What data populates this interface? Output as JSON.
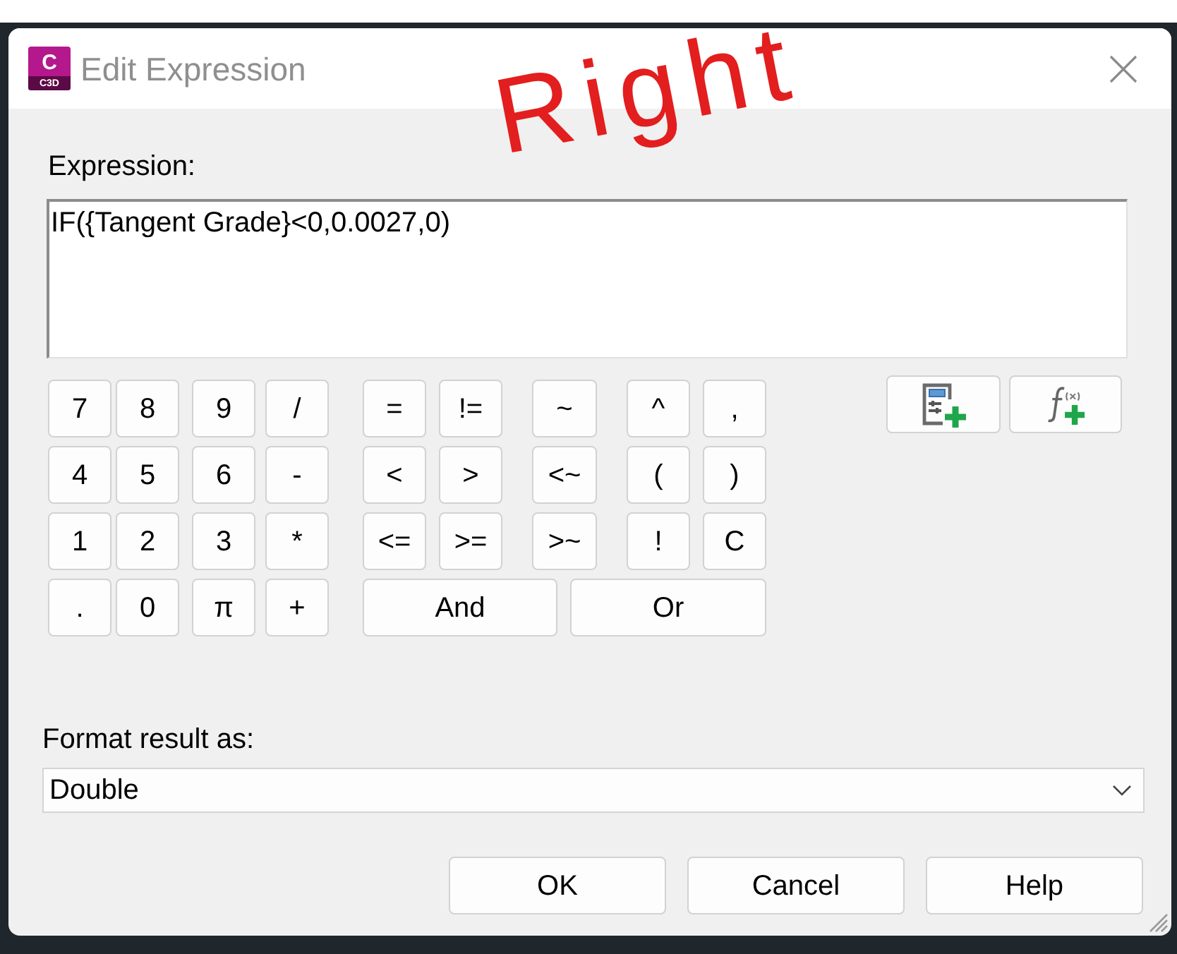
{
  "window": {
    "title": "Edit Expression",
    "app_icon": {
      "letter": "C",
      "caption": "C3D"
    }
  },
  "handwritten_note": "Right",
  "expression": {
    "label": "Expression:",
    "value": "IF({Tangent Grade}<0,0.0027,0)"
  },
  "keypad": {
    "rows": [
      [
        "7",
        "8",
        "9",
        "/",
        "=",
        "!=",
        "~",
        "^",
        ","
      ],
      [
        "4",
        "5",
        "6",
        "-",
        "<",
        ">",
        "<~",
        "(",
        ")"
      ],
      [
        "1",
        "2",
        "3",
        "*",
        "<=",
        ">=",
        ">~",
        "!",
        "C"
      ],
      [
        ".",
        "0",
        "π",
        "+"
      ]
    ],
    "logic_buttons": [
      "And",
      "Or"
    ]
  },
  "format": {
    "label": "Format result as:",
    "value": "Double"
  },
  "buttons": [
    "OK",
    "Cancel",
    "Help"
  ]
}
